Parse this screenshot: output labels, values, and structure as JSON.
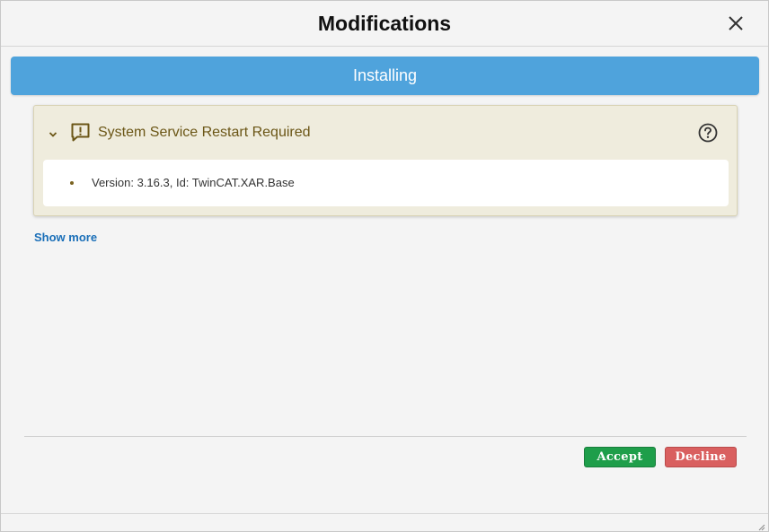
{
  "dialog": {
    "title": "Modifications",
    "close_icon": "close-icon"
  },
  "status": {
    "label": "Installing",
    "color": "#4fa3dc"
  },
  "notice": {
    "title": "System Service Restart Required",
    "icons": [
      "chevron-down-icon",
      "warning-message-icon",
      "help-icon"
    ],
    "items": [
      {
        "text": "Version: 3.16.3, Id: TwinCAT.XAR.Base"
      }
    ]
  },
  "show_more_label": "Show more",
  "actions": {
    "accept_label": "Accept",
    "decline_label": "Decline",
    "accept_color": "#1e9e4a",
    "decline_color": "#d95f5f"
  }
}
